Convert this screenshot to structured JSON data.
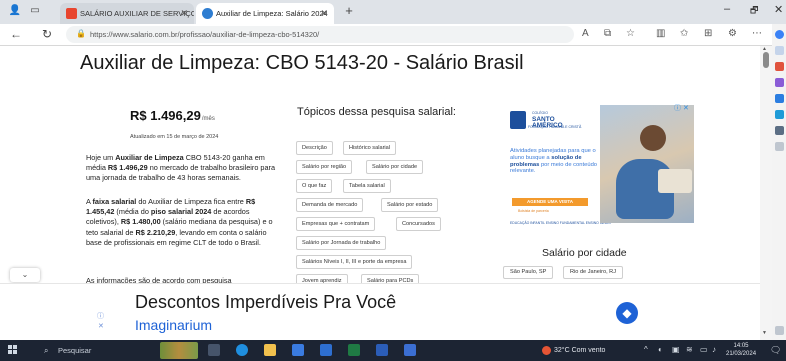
{
  "browser": {
    "tabs": [
      {
        "label": "SALÁRIO AUXILIAR DE SERVIÇOS",
        "active": false
      },
      {
        "label": "Auxiliar de Limpeza: Salário 2024",
        "active": true
      }
    ],
    "new_tab": "+",
    "url": "https://www.salario.com.br/profissao/auxiliar-de-limpeza-cbo-514320/",
    "window_controls": {
      "minimize": "–",
      "maximize": "🗗",
      "close": "✕"
    }
  },
  "page": {
    "title": "Auxiliar de Limpeza: CBO 5143-20 - Salário Brasil",
    "salary": "R$ 1.496,29",
    "salary_suffix": "/mês",
    "updated": "Atualizado em 15 de março de 2024",
    "paragraphs": [
      [
        {
          "t": "Hoje um "
        },
        {
          "t": "Auxiliar de Limpeza",
          "b": true
        },
        {
          "t": " CBO 5143-20 ganha em média "
        },
        {
          "t": "R$ 1.496,29",
          "b": true
        },
        {
          "t": " no mercado de trabalho brasileiro para uma jornada de trabalho de 43 horas semanais."
        }
      ],
      [
        {
          "t": "A "
        },
        {
          "t": "faixa salarial",
          "b": true
        },
        {
          "t": " do Auxiliar de Limpeza fica entre "
        },
        {
          "t": "R$ 1.455,42",
          "b": true
        },
        {
          "t": " (média do "
        },
        {
          "t": "piso salarial 2024",
          "b": true
        },
        {
          "t": " de acordos coletivos), "
        },
        {
          "t": "R$ 1.480,00",
          "b": true
        },
        {
          "t": " (salário mediana da pesquisa) e o teto salarial de "
        },
        {
          "t": "R$ 2.210,29",
          "b": true
        },
        {
          "t": ", levando em conta o salário base de profissionais em regime CLT de todo o Brasil."
        }
      ],
      [
        {
          "t": "As informações são de acordo com pesquisa"
        }
      ]
    ],
    "topics_title": "Tópicos dessa pesquisa salarial:",
    "topics": [
      "Descrição",
      "Histórico salarial",
      "Salário por região",
      "Salário por cidade",
      "O que faz",
      "Tabela salarial",
      "Demanda de mercado",
      "Salário por estado",
      "Empresas que + contratam",
      "Concursados",
      "Salário por Jornada de trabalho",
      "Salários Níveis I, II, III e porte da empresa",
      "Jovem aprendiz",
      "Salário para PCDs"
    ],
    "city_title": "Salário por cidade",
    "cities": [
      "São Paulo, SP",
      "Rio de Janeiro, RJ"
    ],
    "scroll_chevron": "⌄"
  },
  "side_ad": {
    "brand_line1": "SANTO",
    "brand_line2": "AMÉRICO",
    "brand_top": "COLÉGIO",
    "brand_sub": "FORMAÇÃO HUMANA E CRISTÃ",
    "text_pre": "Atividades planejadas para que o aluno busque a ",
    "text_bold": "solução de problemas",
    "text_post": " por meio de conteúdo relevante.",
    "cta": "AGENDE UMA VISITA",
    "cta_sub": "Bolsista de parceria",
    "footer": "EDUCAÇÃO INFANTIL   ENSINO FUNDAMENTAL   ENSINO MÉDIO",
    "badge": "ⓘ ✕"
  },
  "bottom_ad": {
    "title": "Descontos Imperdíveis Pra Você",
    "brand": "Imaginarium",
    "info": "ⓘ",
    "close": "✕",
    "arrow": "◆"
  },
  "taskbar": {
    "search_placeholder": "Pesquisar",
    "weather": "32°C  Com vento",
    "time": "14:05",
    "date": "21/03/2024"
  },
  "colors": {
    "accent_blue": "#1e62d6",
    "ad_orange": "#f39a2c",
    "taskbar": "#1c2433"
  }
}
